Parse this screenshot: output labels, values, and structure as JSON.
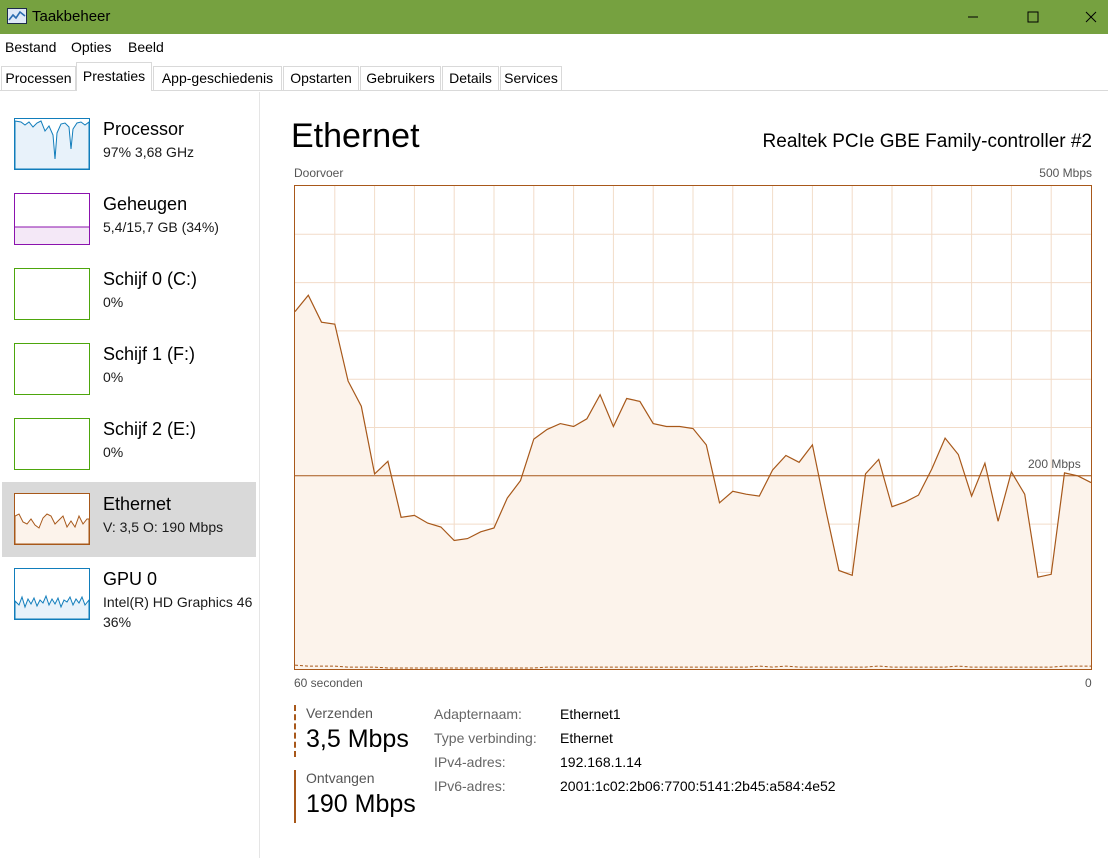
{
  "window": {
    "title": "Taakbeheer",
    "icon": "task-manager-icon"
  },
  "menu": [
    "Bestand",
    "Opties",
    "Beeld"
  ],
  "tabs": [
    "Processen",
    "Prestaties",
    "App-geschiedenis",
    "Opstarten",
    "Gebruikers",
    "Details",
    "Services"
  ],
  "active_tab": "Prestaties",
  "sidebar": {
    "items": [
      {
        "name": "Processor",
        "line1": "97% 3,68 GHz",
        "line2": "",
        "color": "#117dbb"
      },
      {
        "name": "Geheugen",
        "line1": "5,4/15,7 GB (34%)",
        "line2": "",
        "color": "#8b12ae"
      },
      {
        "name": "Schijf 0 (C:)",
        "line1": "0%",
        "line2": "",
        "color": "#4da60c"
      },
      {
        "name": "Schijf 1 (F:)",
        "line1": "0%",
        "line2": "",
        "color": "#4da60c"
      },
      {
        "name": "Schijf 2 (E:)",
        "line1": "0%",
        "line2": "",
        "color": "#4da60c"
      },
      {
        "name": "Ethernet",
        "line1": "V: 3,5  O: 190 Mbps",
        "line2": "",
        "color": "#a7581a"
      },
      {
        "name": "GPU 0",
        "line1": "Intel(R) HD Graphics 46",
        "line2": "36%",
        "color": "#117dbb"
      }
    ],
    "selected": "Ethernet"
  },
  "main": {
    "title": "Ethernet",
    "adapter": "Realtek PCIe GBE Family-controller #2",
    "graph_label": "Doorvoer",
    "graph_max": "500 Mbps",
    "graph_mid": "200 Mbps",
    "x_left": "60 seconden",
    "x_right": "0",
    "send_label": "Verzenden",
    "send_value": "3,5 Mbps",
    "recv_label": "Ontvangen",
    "recv_value": "190 Mbps",
    "props": [
      {
        "label": "Adapternaam:",
        "value": "Ethernet1"
      },
      {
        "label": "Type verbinding:",
        "value": "Ethernet"
      },
      {
        "label": "IPv4-adres:",
        "value": "192.168.1.14"
      },
      {
        "label": "IPv6-adres:",
        "value": "2001:1c02:2b06:7700:5141:2b45:a584:4e52"
      }
    ],
    "colors": {
      "accent": "#a7581a",
      "fill": "#fcf3eb",
      "grid": "#f2dcc9"
    }
  },
  "chart_data": {
    "type": "area",
    "x_range_seconds": [
      60,
      0
    ],
    "y_range_mbps": [
      0,
      500
    ],
    "scale_line_mbps": 200,
    "series": [
      {
        "name": "Ontvangen",
        "values": [
          370,
          387,
          359,
          357,
          298,
          272,
          202,
          215,
          157,
          159,
          151,
          147,
          133,
          135,
          142,
          146,
          177,
          195,
          238,
          248,
          254,
          251,
          259,
          284,
          251,
          280,
          277,
          254,
          251,
          251,
          249,
          232,
          172,
          184,
          181,
          179,
          206,
          221,
          214,
          232,
          165,
          102,
          97,
          202,
          217,
          168,
          173,
          180,
          207,
          239,
          222,
          179,
          213,
          153,
          204,
          181,
          95,
          98,
          203,
          200,
          193
        ],
        "style": "solid"
      },
      {
        "name": "Verzenden",
        "values": [
          4,
          3,
          3,
          3,
          2,
          2,
          2,
          1,
          1,
          1,
          1,
          1,
          1,
          1,
          1,
          1,
          1,
          1,
          1,
          2,
          2,
          2,
          2,
          2,
          2,
          2,
          2,
          2,
          2,
          2,
          2,
          2,
          2,
          2,
          2,
          3,
          2,
          3,
          2,
          2,
          2,
          2,
          2,
          2,
          3,
          2,
          2,
          2,
          2,
          2,
          3,
          2,
          2,
          2,
          2,
          2,
          2,
          2,
          3,
          3,
          3
        ],
        "style": "dashed"
      }
    ]
  }
}
